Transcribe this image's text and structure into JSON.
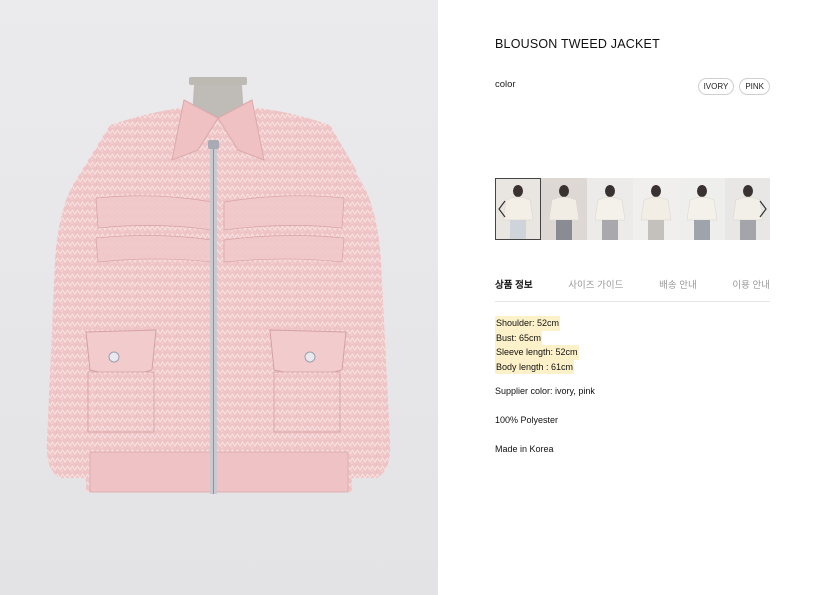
{
  "product": {
    "title": "BLOUSON TWEED JACKET",
    "image_alt": "pink tweed blouson jacket on mannequin"
  },
  "color": {
    "label": "color",
    "options": [
      "IVORY",
      "PINK"
    ]
  },
  "gallery": {
    "thumbnails": [
      {
        "shirt": "#f3efe6",
        "bg": "#e9e6e2",
        "pants": "#cfd3da"
      },
      {
        "shirt": "#f1ede4",
        "bg": "#ddd8d4",
        "pants": "#8b8b94"
      },
      {
        "shirt": "#f4f1ea",
        "bg": "#ecebea",
        "pants": "#a9a8ad"
      },
      {
        "shirt": "#f2eee6",
        "bg": "#f0efee",
        "pants": "#c4c1bd"
      },
      {
        "shirt": "#f4f1ea",
        "bg": "#eeeeed",
        "pants": "#9fa3ab"
      },
      {
        "shirt": "#f2efe8",
        "bg": "#e8e7e6",
        "pants": "#a3a5aa"
      }
    ],
    "prev_icon": "chevron-left-icon",
    "next_icon": "chevron-right-icon"
  },
  "tabs": [
    {
      "label": "상품 정보",
      "active": true
    },
    {
      "label": "사이즈 가이드",
      "active": false
    },
    {
      "label": "배송 안내",
      "active": false
    },
    {
      "label": "이용 안내",
      "active": false
    }
  ],
  "specs": [
    "Shoulder: 52cm",
    "Bust: 65cm",
    "Sleeve length: 52cm",
    "Body length : 61cm"
  ],
  "info": {
    "supplier_color": "Supplier color: ivory, pink",
    "material": "100% Polyester",
    "origin": "Made in Korea"
  },
  "colors": {
    "jacket_pink": "#f0c6c8",
    "highlight": "#fdf1c9",
    "tab_inactive": "#9a9a9a"
  }
}
